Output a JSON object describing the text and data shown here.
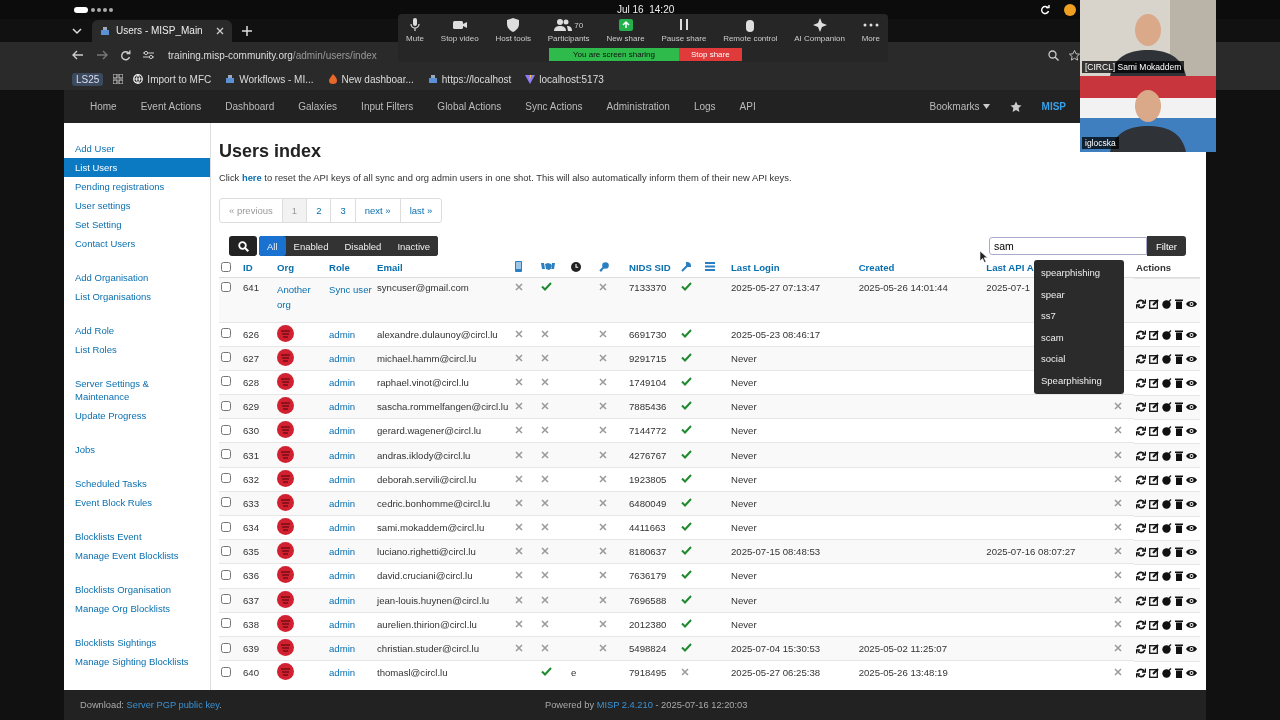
{
  "system_bar": {
    "clock": "Jul 16  14:20"
  },
  "browser": {
    "tab": "Users - MISP_Main",
    "url_host": "training.misp-community.org",
    "url_path": "/admin/users/index",
    "bookmarks": [
      {
        "label": "LS25",
        "kind": "tag"
      },
      {
        "label": "Import to MFC",
        "kind": "globe"
      },
      {
        "label": "Workflows - MI...",
        "kind": "page"
      },
      {
        "label": "New dashboar...",
        "kind": "flame"
      },
      {
        "label": "https://localhost",
        "kind": "page"
      },
      {
        "label": "localhost:5173",
        "kind": "vite"
      }
    ]
  },
  "meeting_toolbar": {
    "items": [
      {
        "label": "Mute",
        "kind": "mic"
      },
      {
        "label": "Stop video",
        "kind": "camera"
      },
      {
        "label": "Host tools",
        "kind": "shield"
      },
      {
        "label": "Participants",
        "kind": "people",
        "count": "70"
      },
      {
        "label": "New share",
        "kind": "share"
      },
      {
        "label": "Pause share",
        "kind": "pause"
      },
      {
        "label": "Remote control",
        "kind": "mouse"
      },
      {
        "label": "AI Companion",
        "kind": "sparkle"
      },
      {
        "label": "More",
        "kind": "dots"
      }
    ],
    "sharing_notice": "You are screen sharing",
    "stop_share": "Stop share"
  },
  "video_tiles": [
    {
      "name": "[CIRCL] Sami Mokaddem"
    },
    {
      "name": "iglocska"
    }
  ],
  "navbar": {
    "items": [
      "Home",
      "Event Actions",
      "Dashboard",
      "Galaxies",
      "Input Filters",
      "Global Actions",
      "Sync Actions",
      "Administration",
      "Logs",
      "API"
    ],
    "bookmarks": "Bookmarks",
    "brand": "MISP"
  },
  "sidebar": {
    "groups": [
      [
        {
          "label": "Add User",
          "selected": false
        },
        {
          "label": "List Users",
          "selected": true
        },
        {
          "label": "Pending registrations",
          "selected": false
        },
        {
          "label": "User settings",
          "selected": false
        },
        {
          "label": "Set Setting",
          "selected": false
        },
        {
          "label": "Contact Users",
          "selected": false
        }
      ],
      [
        {
          "label": "Add Organisation",
          "selected": false
        },
        {
          "label": "List Organisations",
          "selected": false
        }
      ],
      [
        {
          "label": "Add Role",
          "selected": false
        },
        {
          "label": "List Roles",
          "selected": false
        }
      ],
      [
        {
          "label": "Server Settings & Maintenance",
          "selected": false
        },
        {
          "label": "Update Progress",
          "selected": false
        }
      ],
      [
        {
          "label": "Jobs",
          "selected": false
        }
      ],
      [
        {
          "label": "Scheduled Tasks",
          "selected": false
        },
        {
          "label": "Event Block Rules",
          "selected": false
        }
      ],
      [
        {
          "label": "Blocklists Event",
          "selected": false
        },
        {
          "label": "Manage Event Blocklists",
          "selected": false
        }
      ],
      [
        {
          "label": "Blocklists Organisation",
          "selected": false
        },
        {
          "label": "Manage Org Blocklists",
          "selected": false
        }
      ],
      [
        {
          "label": "Blocklists Sightings",
          "selected": false
        },
        {
          "label": "Manage Sighting Blocklists",
          "selected": false
        }
      ]
    ]
  },
  "page": {
    "title": "Users index",
    "notice_before": "Click",
    "notice_link": "here",
    "notice_after": "to reset the API keys of all sync and org admin users in one shot. This will also automatically inform them of their new API keys."
  },
  "pagination": [
    {
      "label": "« previous",
      "selected": false,
      "disabled": true
    },
    {
      "label": "1",
      "selected": true,
      "disabled": false
    },
    {
      "label": "2",
      "selected": false,
      "disabled": false
    },
    {
      "label": "3",
      "selected": false,
      "disabled": false
    },
    {
      "label": "next »",
      "selected": false,
      "disabled": false
    },
    {
      "label": "last »",
      "selected": false,
      "disabled": false
    }
  ],
  "filter_tabs": [
    {
      "label": "All",
      "selected": true
    },
    {
      "label": "Enabled",
      "selected": false
    },
    {
      "label": "Disabled",
      "selected": false
    },
    {
      "label": "Inactive",
      "selected": false
    }
  ],
  "search": {
    "value": "sam",
    "button": "Filter",
    "suggestions": [
      "spearphishing",
      "spear",
      "ss7",
      "scam",
      "social",
      "Spearphishing"
    ]
  },
  "table": {
    "select_all": {
      "checked": false
    },
    "columns": [
      "ID",
      "Org",
      "Role",
      "Email",
      "NIDS SID",
      "Last Login",
      "Created",
      "Last API A",
      "Actions"
    ],
    "rows": [
      {
        "checked": false,
        "id": "641",
        "org": {
          "kind": "link",
          "name": "Another org"
        },
        "role": "Sync user",
        "email": "syncuser@gmail.com",
        "contact": false,
        "sync": true,
        "key": false,
        "nids": "7133370",
        "admin": true,
        "last_login": "2025-05-27 07:13:47",
        "created": "2025-05-26 14:01:44",
        "last_api": "2025-07-1"
      },
      {
        "checked": false,
        "id": "626",
        "org": {
          "kind": "logo"
        },
        "role": "admin",
        "email": "alexandre.dulaunoy@circl.lu",
        "contact": false,
        "sync": false,
        "key": false,
        "nids": "6691730",
        "admin": true,
        "last_login": "2025-05-23 08:46:17"
      },
      {
        "checked": false,
        "id": "627",
        "org": {
          "kind": "logo"
        },
        "role": "admin",
        "email": "michael.hamm@circl.lu",
        "contact": false,
        "sync": false,
        "key": false,
        "nids": "9291715",
        "admin": true,
        "last_login": "Never"
      },
      {
        "checked": false,
        "id": "628",
        "org": {
          "kind": "logo"
        },
        "role": "admin",
        "email": "raphael.vinot@circl.lu",
        "contact": false,
        "sync": false,
        "key": false,
        "nids": "1749104",
        "admin": true,
        "last_login": "Never"
      },
      {
        "checked": false,
        "id": "629",
        "org": {
          "kind": "logo"
        },
        "role": "admin",
        "email": "sascha.rommelfangen@circl.lu",
        "contact": false,
        "sync": false,
        "key": false,
        "nids": "7885436",
        "admin": true,
        "last_login": "Never",
        "disabled": false
      },
      {
        "checked": false,
        "id": "630",
        "org": {
          "kind": "logo"
        },
        "role": "admin",
        "email": "gerard.wagener@circl.lu",
        "contact": false,
        "sync": false,
        "key": false,
        "nids": "7144772",
        "admin": true,
        "last_login": "Never",
        "disabled": false
      },
      {
        "checked": false,
        "id": "631",
        "org": {
          "kind": "logo"
        },
        "role": "admin",
        "email": "andras.iklody@circl.lu",
        "contact": false,
        "sync": false,
        "key": false,
        "nids": "4276767",
        "admin": true,
        "last_login": "Never",
        "disabled": false
      },
      {
        "checked": false,
        "id": "632",
        "org": {
          "kind": "logo"
        },
        "role": "admin",
        "email": "deborah.servili@circl.lu",
        "contact": false,
        "sync": false,
        "key": false,
        "nids": "1923805",
        "admin": true,
        "last_login": "Never",
        "disabled": false
      },
      {
        "checked": false,
        "id": "633",
        "org": {
          "kind": "logo"
        },
        "role": "admin",
        "email": "cedric.bonhomme@circl.lu",
        "contact": false,
        "sync": false,
        "key": false,
        "nids": "6480049",
        "admin": true,
        "last_login": "Never",
        "disabled": false
      },
      {
        "checked": false,
        "id": "634",
        "org": {
          "kind": "logo"
        },
        "role": "admin",
        "email": "sami.mokaddem@circl.lu",
        "contact": false,
        "sync": false,
        "key": false,
        "nids": "4411663",
        "admin": true,
        "last_login": "Never",
        "disabled": false
      },
      {
        "checked": false,
        "id": "635",
        "org": {
          "kind": "logo"
        },
        "role": "admin",
        "email": "luciano.righetti@circl.lu",
        "contact": false,
        "sync": false,
        "key": false,
        "nids": "8180637",
        "admin": true,
        "last_login": "2025-07-15 08:48:53",
        "last_api": "2025-07-16 08:07:27",
        "disabled": false
      },
      {
        "checked": false,
        "id": "636",
        "org": {
          "kind": "logo"
        },
        "role": "admin",
        "email": "david.cruciani@circl.lu",
        "contact": false,
        "sync": false,
        "key": false,
        "nids": "7636179",
        "admin": true,
        "last_login": "Never",
        "disabled": false
      },
      {
        "checked": false,
        "id": "637",
        "org": {
          "kind": "logo"
        },
        "role": "admin",
        "email": "jean-louis.huynen@circl.lu",
        "contact": false,
        "sync": false,
        "key": false,
        "nids": "7696588",
        "admin": true,
        "last_login": "Never",
        "disabled": false
      },
      {
        "checked": false,
        "id": "638",
        "org": {
          "kind": "logo"
        },
        "role": "admin",
        "email": "aurelien.thirion@circl.lu",
        "contact": false,
        "sync": false,
        "key": false,
        "nids": "2012380",
        "admin": true,
        "last_login": "Never",
        "disabled": false
      },
      {
        "checked": false,
        "id": "639",
        "org": {
          "kind": "logo"
        },
        "role": "admin",
        "email": "christian.studer@circl.lu",
        "contact": false,
        "sync": false,
        "key": false,
        "nids": "5498824",
        "admin": true,
        "last_login": "2025-07-04 15:30:53",
        "created": "2025-05-02 11:25:07",
        "disabled": false
      },
      {
        "checked": false,
        "id": "640",
        "org": {
          "kind": "logo"
        },
        "role": "admin",
        "email": "thomasl@circl.lu",
        "sync": true,
        "expiry": "e",
        "nids": "7918495",
        "admin": false,
        "last_login": "2025-05-27 06:25:38",
        "created": "2025-05-26 13:48:19",
        "disabled": false
      }
    ]
  },
  "footer": {
    "download_label": "Download:",
    "download_link": "Server PGP public key",
    "download_end": ".",
    "powered_by": "Powered by",
    "version_link": "MISP 2.4.210",
    "build": "- 2025-07-16 12:20:03"
  }
}
